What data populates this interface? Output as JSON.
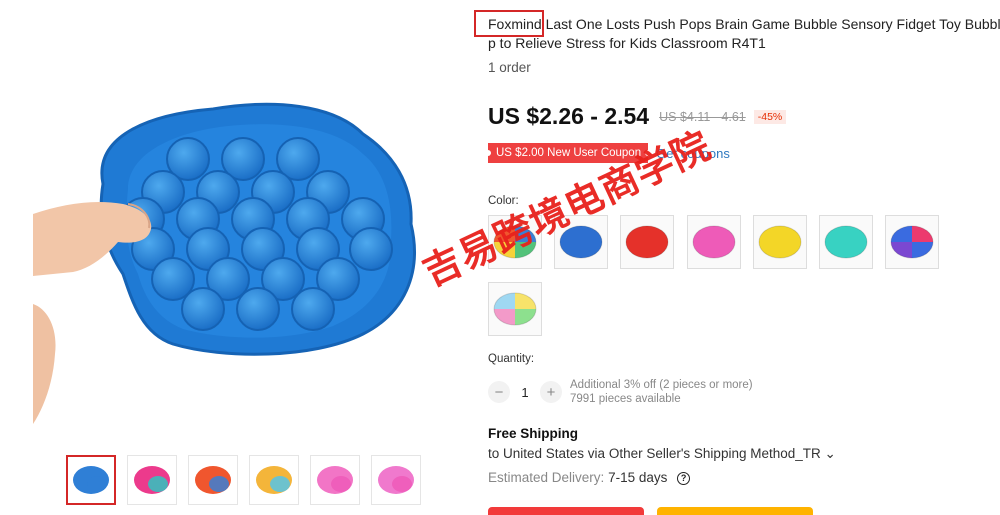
{
  "product": {
    "brand": "Foxmind",
    "title_line1": "Last One Losts Push Pops Brain Game Bubble Sensory Fidget Toy Bubble (",
    "title_line2": "p to Relieve Stress for Kids Classroom R4T1",
    "orders": "1 order"
  },
  "pricing": {
    "price": "US $2.26 - 2.54",
    "original": "US $4.11 - 4.61",
    "discount": "-45%",
    "coupon": "US $2.00 New User Coupon",
    "get_coupons": "Get coupons"
  },
  "color": {
    "label": "Color:",
    "swatches": [
      {
        "name": "rainbow-round",
        "colors": [
          "#f0562e",
          "#3a7fd5",
          "#f6d23a",
          "#52c27a"
        ]
      },
      {
        "name": "blue-heart",
        "colors": [
          "#2d6fd0",
          "#2d6fd0",
          "#2d6fd0",
          "#2d6fd0"
        ]
      },
      {
        "name": "red-square",
        "colors": [
          "#e5312a",
          "#e5312a",
          "#e5312a",
          "#e5312a"
        ]
      },
      {
        "name": "pink-round",
        "colors": [
          "#ee5bb8",
          "#ee5bb8",
          "#ee5bb8",
          "#ee5bb8"
        ]
      },
      {
        "name": "yellow-round",
        "colors": [
          "#f3d627",
          "#f3d627",
          "#f3d627",
          "#f3d627"
        ]
      },
      {
        "name": "teal-octagon",
        "colors": [
          "#38d2c2",
          "#38d2c2",
          "#38d2c2",
          "#38d2c2"
        ]
      },
      {
        "name": "multi-round",
        "colors": [
          "#3a6be0",
          "#ec3a6e",
          "#7b48d1",
          "#3a6be0"
        ]
      },
      {
        "name": "pastel-rainbow",
        "colors": [
          "#9fd8f2",
          "#f7e36a",
          "#f39ac9",
          "#8de08e"
        ]
      }
    ]
  },
  "quantity": {
    "label": "Quantity:",
    "minus": "−",
    "value": "1",
    "plus": "+",
    "note1": "Additional 3% off (2 pieces or more)",
    "note2": "7991 pieces available"
  },
  "shipping": {
    "title": "Free Shipping",
    "destination": "to United States via Other Seller's Shipping Method_TR",
    "chevron": "⌄",
    "delivery_label": "Estimated Delivery:",
    "delivery_days": "7-15 days",
    "help": "?"
  },
  "watermark": "吉易跨境电商学院",
  "thumbnails": [
    {
      "name": "thumb-blue-round",
      "colors": [
        "#2f7fd6",
        "#2f7fd6"
      ]
    },
    {
      "name": "thumb-pink-teal",
      "colors": [
        "#ec3a8c",
        "#2fc6c0"
      ]
    },
    {
      "name": "thumb-rainbow-trio",
      "colors": [
        "#f0562e",
        "#3a7fd5"
      ]
    },
    {
      "name": "thumb-rainbow-hand",
      "colors": [
        "#f4b53a",
        "#55c4e8"
      ]
    },
    {
      "name": "thumb-pink-stack",
      "colors": [
        "#f275c6",
        "#ee5bb8"
      ]
    },
    {
      "name": "thumb-pink-single",
      "colors": [
        "#f079cd",
        "#ee5bb8"
      ]
    }
  ]
}
